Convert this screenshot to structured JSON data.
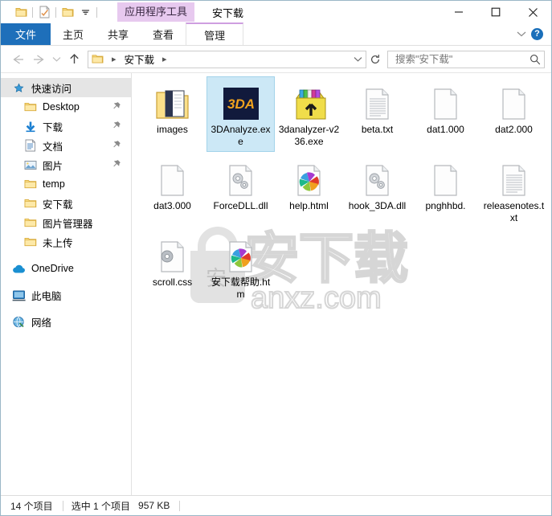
{
  "window": {
    "title": "安下载",
    "contextual_tool_label": "应用程序工具",
    "controls": {
      "minimize": "minimize-icon",
      "maximize": "maximize-icon",
      "close": "close-icon"
    }
  },
  "quick_access_toolbar": {
    "items": [
      {
        "name": "folder-icon",
        "label": "属性"
      },
      {
        "name": "properties-icon",
        "label": "属性"
      },
      {
        "name": "new-folder-icon",
        "label": "新建文件夹"
      },
      {
        "name": "chevron-down-icon",
        "label": "自定义快速访问工具栏"
      }
    ]
  },
  "ribbon": {
    "tabs": [
      {
        "label": "文件",
        "state": "file"
      },
      {
        "label": "主页",
        "state": "normal"
      },
      {
        "label": "共享",
        "state": "normal"
      },
      {
        "label": "查看",
        "state": "normal"
      },
      {
        "label": "管理",
        "state": "contextual-active"
      }
    ],
    "collapse_icon": "chevron-down-icon",
    "help_label": "?"
  },
  "address_bar": {
    "back_icon": "arrow-left-icon",
    "forward_icon": "arrow-right-icon",
    "recent_icon": "chevron-down-icon",
    "up_icon": "arrow-up-icon",
    "breadcrumb": {
      "folder_icon": "folder-icon",
      "segments": [
        "安下载"
      ]
    },
    "dropdown_icon": "chevron-down-icon",
    "refresh_icon": "refresh-icon"
  },
  "search": {
    "placeholder": "搜索\"安下载\"",
    "value": "",
    "icon": "search-icon"
  },
  "sidebar": {
    "items": [
      {
        "label": "快速访问",
        "icon": "pin-star-icon",
        "selected": true,
        "indent": false,
        "pinned": false
      },
      {
        "label": "Desktop",
        "icon": "folder-icon",
        "selected": false,
        "indent": true,
        "pinned": true
      },
      {
        "label": "下载",
        "icon": "downloads-icon",
        "selected": false,
        "indent": true,
        "pinned": true
      },
      {
        "label": "文档",
        "icon": "documents-icon",
        "selected": false,
        "indent": true,
        "pinned": true
      },
      {
        "label": "图片",
        "icon": "pictures-icon",
        "selected": false,
        "indent": true,
        "pinned": true
      },
      {
        "label": "temp",
        "icon": "folder-icon",
        "selected": false,
        "indent": true,
        "pinned": false
      },
      {
        "label": "安下载",
        "icon": "folder-icon",
        "selected": false,
        "indent": true,
        "pinned": false
      },
      {
        "label": "图片管理器",
        "icon": "folder-icon",
        "selected": false,
        "indent": true,
        "pinned": false
      },
      {
        "label": "未上传",
        "icon": "folder-icon",
        "selected": false,
        "indent": true,
        "pinned": false
      },
      {
        "label": "OneDrive",
        "icon": "onedrive-icon",
        "selected": false,
        "indent": false,
        "pinned": false
      },
      {
        "label": "此电脑",
        "icon": "this-pc-icon",
        "selected": false,
        "indent": false,
        "pinned": false
      },
      {
        "label": "网络",
        "icon": "network-icon",
        "selected": false,
        "indent": false,
        "pinned": false
      }
    ]
  },
  "files": {
    "items": [
      {
        "name": "images",
        "icon": "folder-open-icon",
        "selected": false
      },
      {
        "name": "3DAnalyze.exe",
        "icon": "3danalyze-app-icon",
        "selected": true
      },
      {
        "name": "3danalyzer-v236.exe",
        "icon": "self-extracting-archive-icon",
        "selected": false
      },
      {
        "name": "beta.txt",
        "icon": "text-document-icon",
        "selected": false
      },
      {
        "name": "dat1.000",
        "icon": "blank-document-icon",
        "selected": false
      },
      {
        "name": "dat2.000",
        "icon": "blank-document-icon",
        "selected": false
      },
      {
        "name": "dat3.000",
        "icon": "blank-document-icon",
        "selected": false
      },
      {
        "name": "ForceDLL.dll",
        "icon": "dll-gears-icon",
        "selected": false
      },
      {
        "name": "help.html",
        "icon": "html-pinwheel-icon",
        "selected": false
      },
      {
        "name": "hook_3DA.dll",
        "icon": "dll-gears-icon",
        "selected": false
      },
      {
        "name": "pnghhbd.",
        "icon": "blank-document-icon",
        "selected": false
      },
      {
        "name": "releasenotes.txt",
        "icon": "text-document-icon",
        "selected": false
      },
      {
        "name": "scroll.css",
        "icon": "css-gear-icon",
        "selected": false
      },
      {
        "name": "安下载帮助.htm",
        "icon": "html-pinwheel-icon",
        "selected": false
      }
    ]
  },
  "watermark": {
    "text_cn": "安下载",
    "text_en": "anxz.com"
  },
  "status_bar": {
    "item_count": "14 个项目",
    "selection": "选中 1 个项目",
    "size": "957 KB"
  },
  "colors": {
    "file_tab_blue": "#1e6fba",
    "contextual_purple": "#e7c9ef",
    "selection_blue": "#cce8f6",
    "accent": "#1a6fba"
  }
}
